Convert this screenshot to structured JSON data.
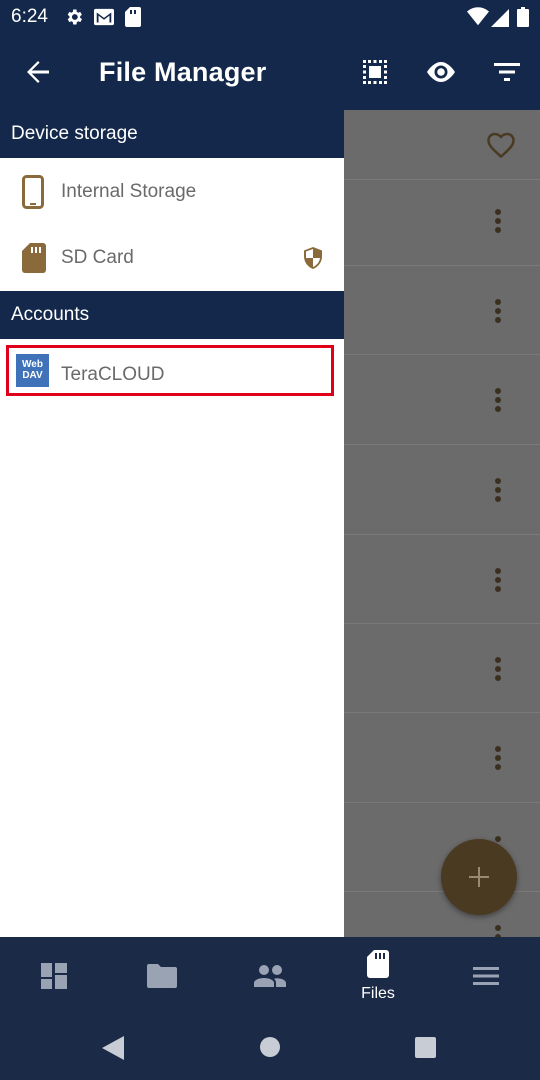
{
  "status": {
    "time": "6:24"
  },
  "appbar": {
    "title": "File Manager"
  },
  "drawer": {
    "device_header": "Device storage",
    "device_items": [
      {
        "label": "Internal Storage"
      },
      {
        "label": "SD Card"
      }
    ],
    "accounts_header": "Accounts",
    "account_items": [
      {
        "label": "TeraCLOUD",
        "badge_line1": "Web",
        "badge_line2": "DAV"
      }
    ]
  },
  "bottom_nav": {
    "files_label": "Files"
  },
  "colors": {
    "primary": "#13284a",
    "accent_brown": "#8a6a3a",
    "highlight": "#e0001a",
    "webdav_blue": "#3f72b8"
  }
}
